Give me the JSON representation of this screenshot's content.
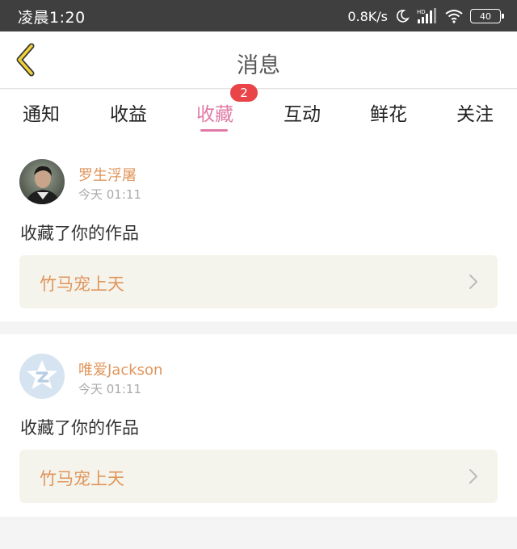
{
  "status_bar": {
    "time": "凌晨1:20",
    "net_speed": "0.8K/s",
    "signal_label": "HD",
    "battery": "40"
  },
  "header": {
    "title": "消息"
  },
  "tabs": [
    {
      "label": "通知",
      "active": false
    },
    {
      "label": "收益",
      "active": false
    },
    {
      "label": "收藏",
      "active": true,
      "badge": "2"
    },
    {
      "label": "互动",
      "active": false
    },
    {
      "label": "鲜花",
      "active": false
    },
    {
      "label": "关注",
      "active": false
    }
  ],
  "colors": {
    "accent": "#e07aa6",
    "badge": "#e94448",
    "name": "#e0955b",
    "link_bg": "#f5f4ec"
  },
  "notifications": [
    {
      "user": "罗生浮屠",
      "time": "今天 01:11",
      "message": "收藏了你的作品",
      "work_title": "竹马宠上天",
      "avatar": "photo-avatar"
    },
    {
      "user": "唯爱Jackson",
      "time": "今天 01:11",
      "message": "收藏了你的作品",
      "work_title": "竹马宠上天",
      "avatar": "default-q-avatar"
    }
  ]
}
